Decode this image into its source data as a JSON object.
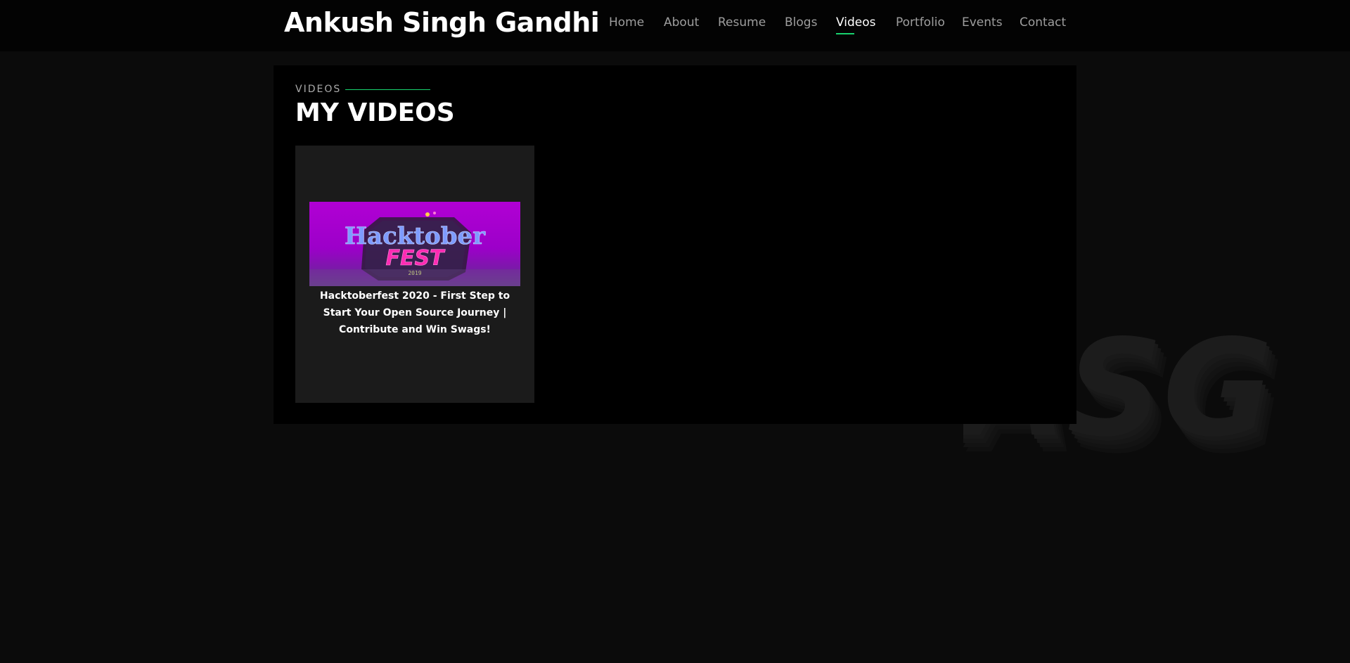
{
  "header": {
    "brand": "Ankush Singh Gandhi",
    "nav": [
      {
        "label": "Home",
        "active": false
      },
      {
        "label": "About",
        "active": false
      },
      {
        "label": "Resume",
        "active": false
      },
      {
        "label": "Blogs",
        "active": false
      },
      {
        "label": "Videos",
        "active": true
      },
      {
        "label": "Portfolio",
        "active": false
      },
      {
        "label": "Events",
        "active": false
      },
      {
        "label": "Contact",
        "active": false
      }
    ]
  },
  "section": {
    "eyebrow": "VIDEOS",
    "title": "MY VIDEOS"
  },
  "videos": [
    {
      "title": "Hacktoberfest 2020 - First Step to Start Your Open Source Journey | Contribute and Win Swags!",
      "thumbnail": {
        "line1": "Hacktober",
        "line2": "FEST",
        "year": "2019"
      }
    }
  ],
  "watermark": "ASG",
  "colors": {
    "accent": "#18d26e",
    "background": "#0b0b0b",
    "panel": "#000000",
    "card": "#1b1b1b",
    "thumbnail": "#b100d4"
  }
}
